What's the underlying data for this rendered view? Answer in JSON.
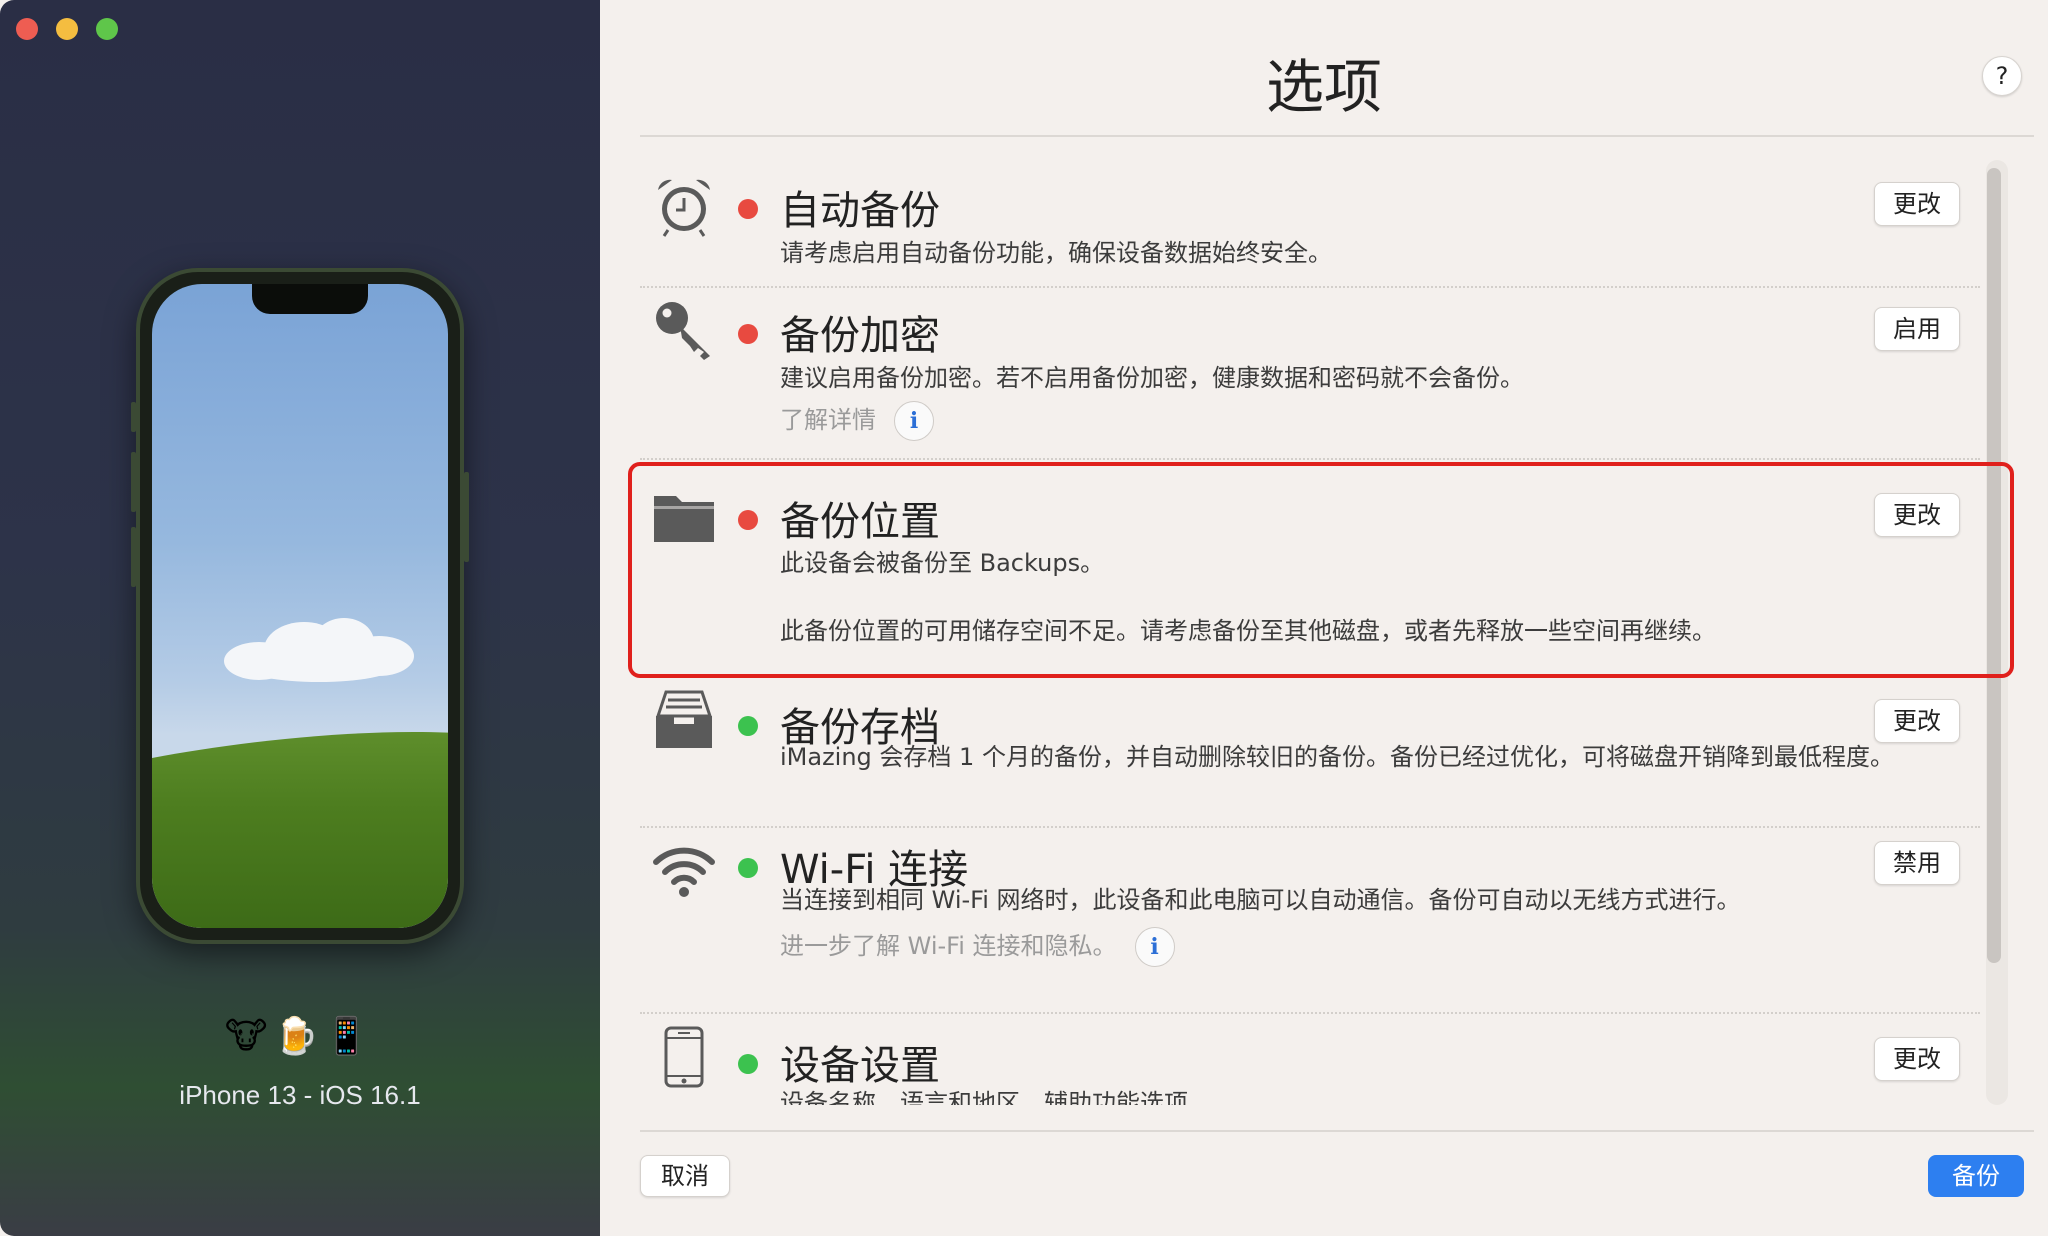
{
  "sidebar": {
    "device_emoji": "🐮🍺📱",
    "device_name": "iPhone 13 - iOS 16.1"
  },
  "header": {
    "title": "选项",
    "help_label": "?"
  },
  "options": [
    {
      "icon": "alarm-clock-icon",
      "status": "red",
      "title": "自动备份",
      "description": "请考虑启用自动备份功能，确保设备数据始终安全。",
      "button": "更改"
    },
    {
      "icon": "key-icon",
      "status": "red",
      "title": "备份加密",
      "description": "建议启用备份加密。若不启用备份加密，健康数据和密码就不会备份。",
      "link": "了解详情",
      "button": "启用"
    },
    {
      "icon": "folder-icon",
      "status": "red",
      "title": "备份位置",
      "description": "此设备会被备份至 Backups。",
      "description2": "此备份位置的可用储存空间不足。请考虑备份至其他磁盘，或者先释放一些空间再继续。",
      "button": "更改"
    },
    {
      "icon": "archive-tray-icon",
      "status": "green",
      "title": "备份存档",
      "description": "iMazing 会存档 1 个月的备份，并自动删除较旧的备份。备份已经过优化，可将磁盘开销降到最低程度。",
      "button": "更改"
    },
    {
      "icon": "wifi-icon",
      "status": "green",
      "title": "Wi-Fi 连接",
      "description": "当连接到相同 Wi-Fi 网络时，此设备和此电脑可以自动通信。备份可自动以无线方式进行。",
      "link": "进一步了解 Wi-Fi 连接和隐私。",
      "button": "禁用"
    },
    {
      "icon": "phone-outline-icon",
      "status": "green",
      "title": "设备设置",
      "description": "设备名称、语言和地区、辅助功能选项",
      "button": "更改"
    }
  ],
  "info_glyph": "i",
  "footer": {
    "cancel_label": "取消",
    "backup_label": "备份"
  },
  "colors": {
    "status_red": "#e84a40",
    "status_green": "#3cc24f",
    "accent_blue": "#2d7ff0",
    "highlight_red": "#e0201c"
  }
}
